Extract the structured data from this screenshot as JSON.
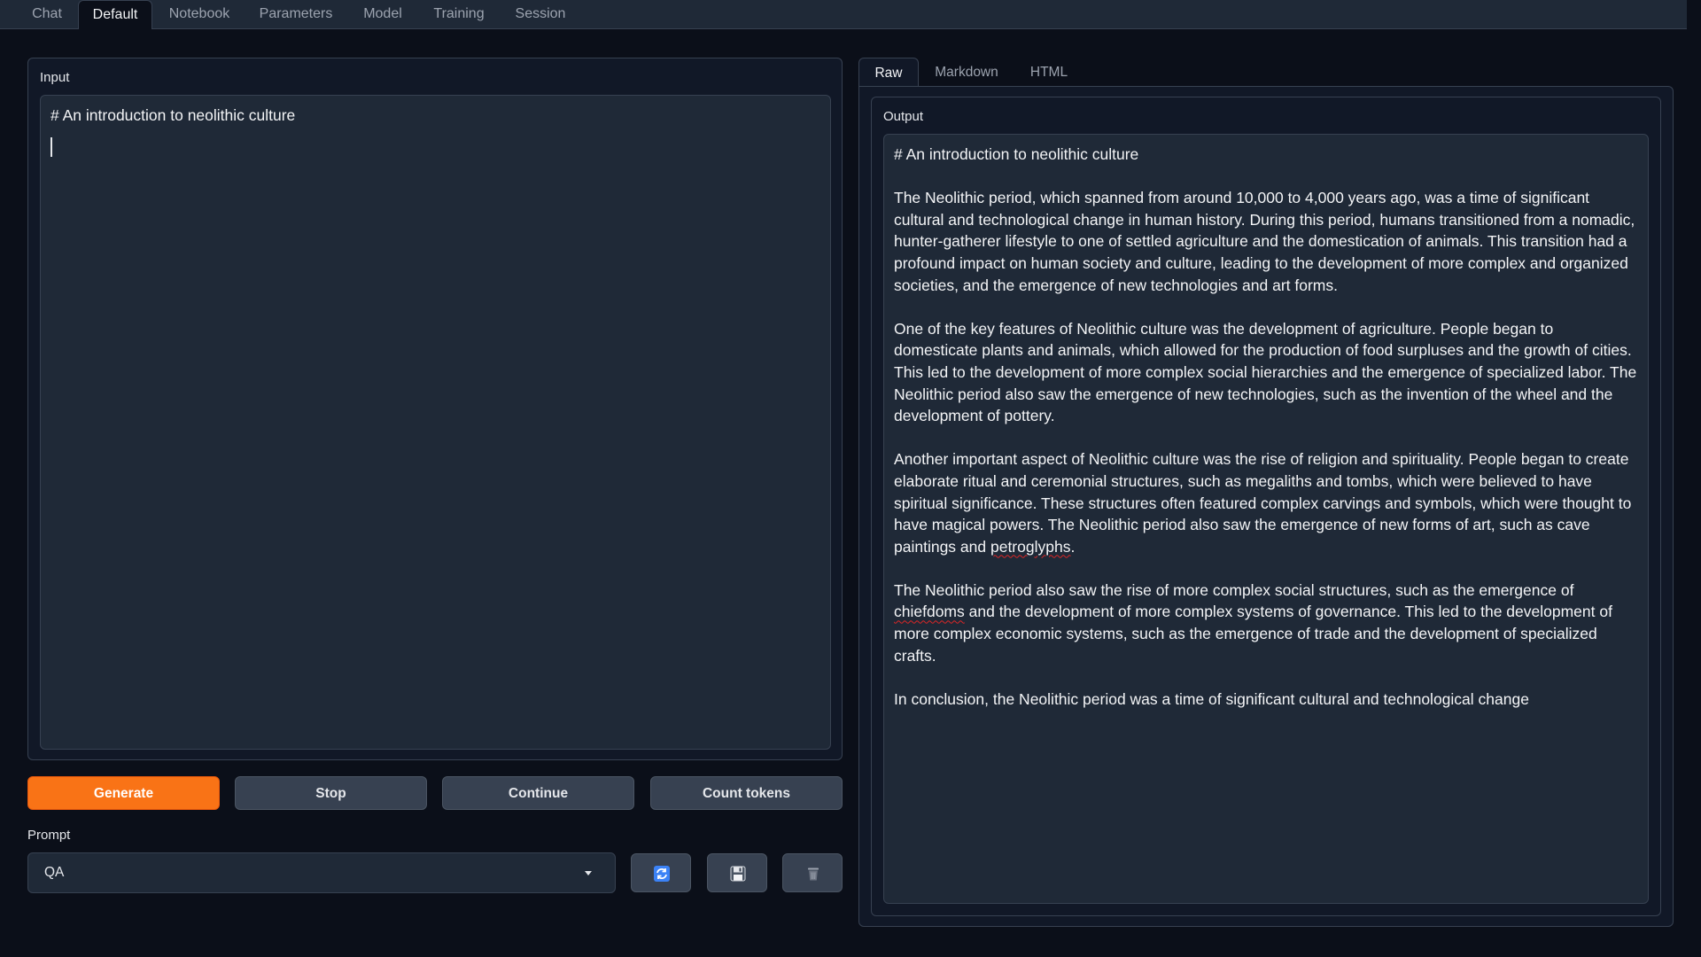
{
  "top_tabs": [
    {
      "label": "Chat",
      "active": false
    },
    {
      "label": "Default",
      "active": true
    },
    {
      "label": "Notebook",
      "active": false
    },
    {
      "label": "Parameters",
      "active": false
    },
    {
      "label": "Model",
      "active": false
    },
    {
      "label": "Training",
      "active": false
    },
    {
      "label": "Session",
      "active": false
    }
  ],
  "input": {
    "label": "Input",
    "value": "# An introduction to neolithic culture"
  },
  "buttons": {
    "generate": "Generate",
    "stop": "Stop",
    "continue": "Continue",
    "count_tokens": "Count tokens"
  },
  "prompt": {
    "label": "Prompt",
    "selected": "QA"
  },
  "icons": {
    "refresh": "refresh-icon",
    "save": "save-icon",
    "delete": "trash-icon"
  },
  "output_tabs": [
    {
      "label": "Raw",
      "active": true
    },
    {
      "label": "Markdown",
      "active": false
    },
    {
      "label": "HTML",
      "active": false
    }
  ],
  "output": {
    "label": "Output",
    "heading": "# An introduction to neolithic culture",
    "p1": "The Neolithic period, which spanned from around 10,000 to 4,000 years ago, was a time of significant cultural and technological change in human history. During this period, humans transitioned from a nomadic, hunter-gatherer lifestyle to one of settled agriculture and the domestication of animals. This transition had a profound impact on human society and culture, leading to the development of more complex and organized societies, and the emergence of new technologies and art forms.",
    "p2": "One of the key features of Neolithic culture was the development of agriculture. People began to domesticate plants and animals, which allowed for the production of food surpluses and the growth of cities. This led to the development of more complex social hierarchies and the emergence of specialized labor. The Neolithic period also saw the emergence of new technologies, such as the invention of the wheel and the development of pottery.",
    "p3_a": "Another important aspect of Neolithic culture was the rise of religion and spirituality. People began to create elaborate ritual and ceremonial structures, such as megaliths and tombs, which were believed to have spiritual significance. These structures often featured complex carvings and symbols, which were thought to have magical powers. The Neolithic period also saw the emergence of new forms of art, such as cave paintings and ",
    "p3_word": "petroglyphs",
    "p3_b": ".",
    "p4_a": "The Neolithic period also saw the rise of more complex social structures, such as the emergence of ",
    "p4_word": "chiefdoms",
    "p4_b": " and the development of more complex systems of governance. This led to the development of more complex economic systems, such as the emergence of trade and the development of specialized crafts.",
    "p5": "In conclusion, the Neolithic period was a time of significant cultural and technological change"
  },
  "colors": {
    "background": "#0b0f19",
    "panel": "#111827",
    "field": "#1f2937",
    "accent": "#f97316",
    "border": "#374151"
  }
}
